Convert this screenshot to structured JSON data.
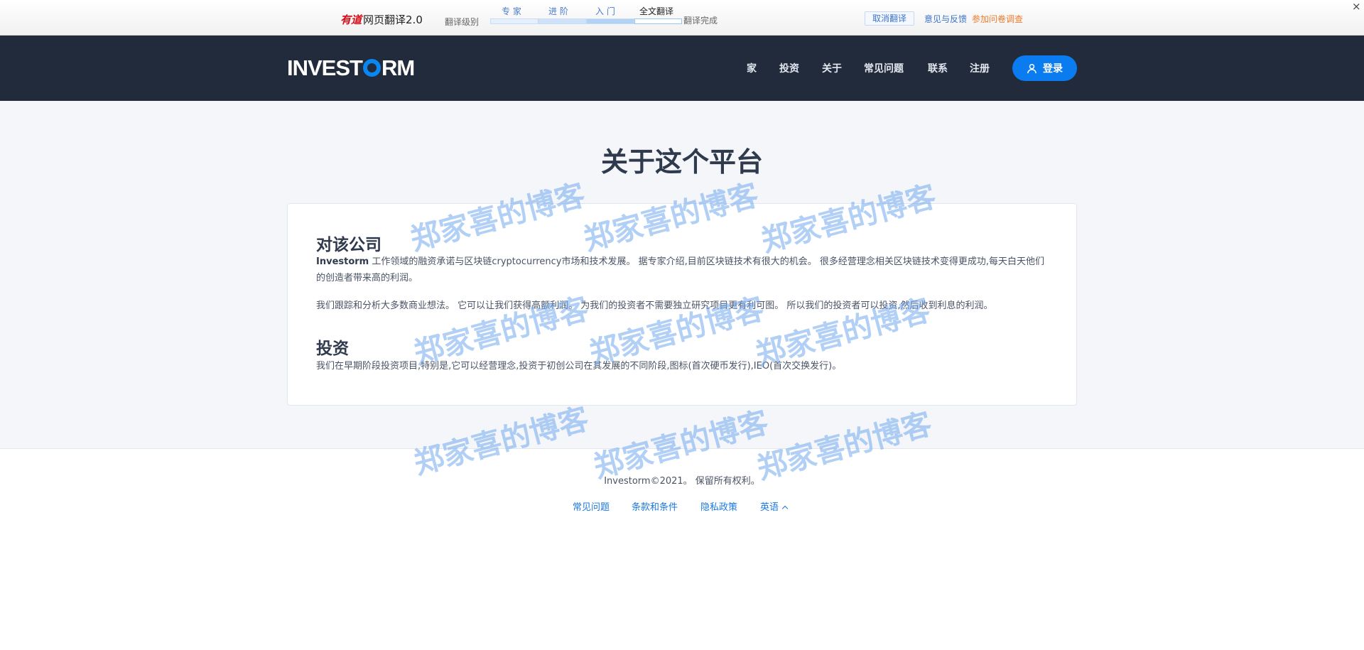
{
  "translator_bar": {
    "brand_mark": "有道",
    "brand_name": "网页翻译2.0",
    "level_label": "翻译级别",
    "levels": [
      "专 家",
      "进 阶",
      "入 门",
      "全文翻译"
    ],
    "status": "翻译完成",
    "cancel_label": "取消翻译",
    "feedback_label": "意见与反馈",
    "survey_label": "参加问卷调查",
    "close_glyph": "×"
  },
  "header": {
    "logo_pre": "INVEST",
    "logo_post": "RM",
    "nav": [
      "家",
      "投资",
      "关于",
      "常见问题",
      "联系",
      "注册"
    ],
    "login_label": "登录",
    "accent_color": "#0a7cf0"
  },
  "main": {
    "title": "关于这个平台",
    "sections": [
      {
        "heading": "对该公司",
        "p1_brand": "Investorm",
        "p1_text": " 工作领域的融资承诺与区块链cryptocurrency市场和技术发展。 据专家介绍,目前区块链技术有很大的机会。 很多经营理念相关区块链技术变得更成功,每天白天他们的创造者带来高的利润。",
        "p2_text": "我们跟踪和分析大多数商业想法。 它可以让我们获得高额利润。 为我们的投资者不需要独立研究项目更有利可图。 所以我们的投资者可以投资,然后收到利息的利润。"
      },
      {
        "heading": "投资",
        "p1_text": "我们在早期阶段投资项目,特别是,它可以经营理念,投资于初创公司在其发展的不同阶段,图标(首次硬币发行),IEO(首次交换发行)。"
      }
    ]
  },
  "footer": {
    "copyright": "Investorm©2021。 保留所有权利。",
    "links": [
      "常见问题",
      "条款和条件",
      "隐私政策",
      "英语"
    ]
  },
  "watermark": "郑家喜的博客"
}
